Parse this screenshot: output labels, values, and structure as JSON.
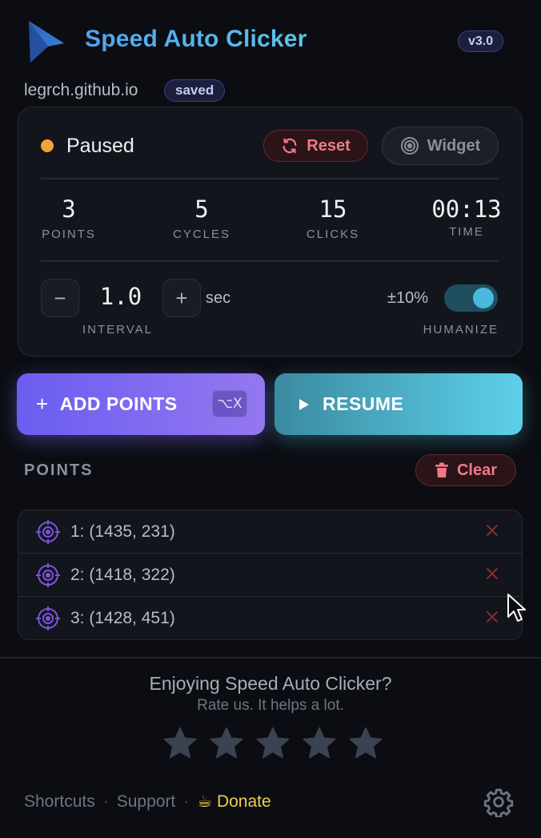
{
  "header": {
    "title": "Speed Auto Clicker",
    "version": "v3.0",
    "domain": "legrch.github.io",
    "saved_badge": "saved"
  },
  "status": {
    "text": "Paused",
    "dot_color": "#f0a43a",
    "reset_label": "Reset",
    "widget_label": "Widget"
  },
  "stats": [
    {
      "value": "3",
      "label": "POINTS"
    },
    {
      "value": "5",
      "label": "CYCLES"
    },
    {
      "value": "15",
      "label": "CLICKS"
    },
    {
      "value": "00:13",
      "label": "TIME"
    }
  ],
  "interval": {
    "value": "1.0",
    "unit": "sec",
    "label": "INTERVAL",
    "minus": "−",
    "plus": "+"
  },
  "humanize": {
    "percent": "±10%",
    "label": "HUMANIZE",
    "enabled": true
  },
  "actions": {
    "add_plus": "+",
    "add_points_label": "ADD POINTS",
    "add_shortcut": "⌥X",
    "resume_label": "RESUME"
  },
  "points": {
    "title": "POINTS",
    "clear_label": "Clear",
    "items": [
      {
        "label": "1: (1435, 231)"
      },
      {
        "label": "2: (1418, 322)"
      },
      {
        "label": "3: (1428, 451)"
      }
    ]
  },
  "footer": {
    "enjoy_text": "Enjoying Speed Auto Clicker?",
    "rate_text": "Rate us. It helps a lot.",
    "star_count": 5,
    "shortcuts_label": "Shortcuts",
    "support_label": "Support",
    "separator": "·",
    "donate_emoji": "☕",
    "donate_label": "Donate"
  },
  "colors": {
    "accent_purple": "#7c6af2",
    "accent_cyan": "#4bb8de",
    "danger": "#f07a86",
    "donate": "#f2cf4a"
  }
}
